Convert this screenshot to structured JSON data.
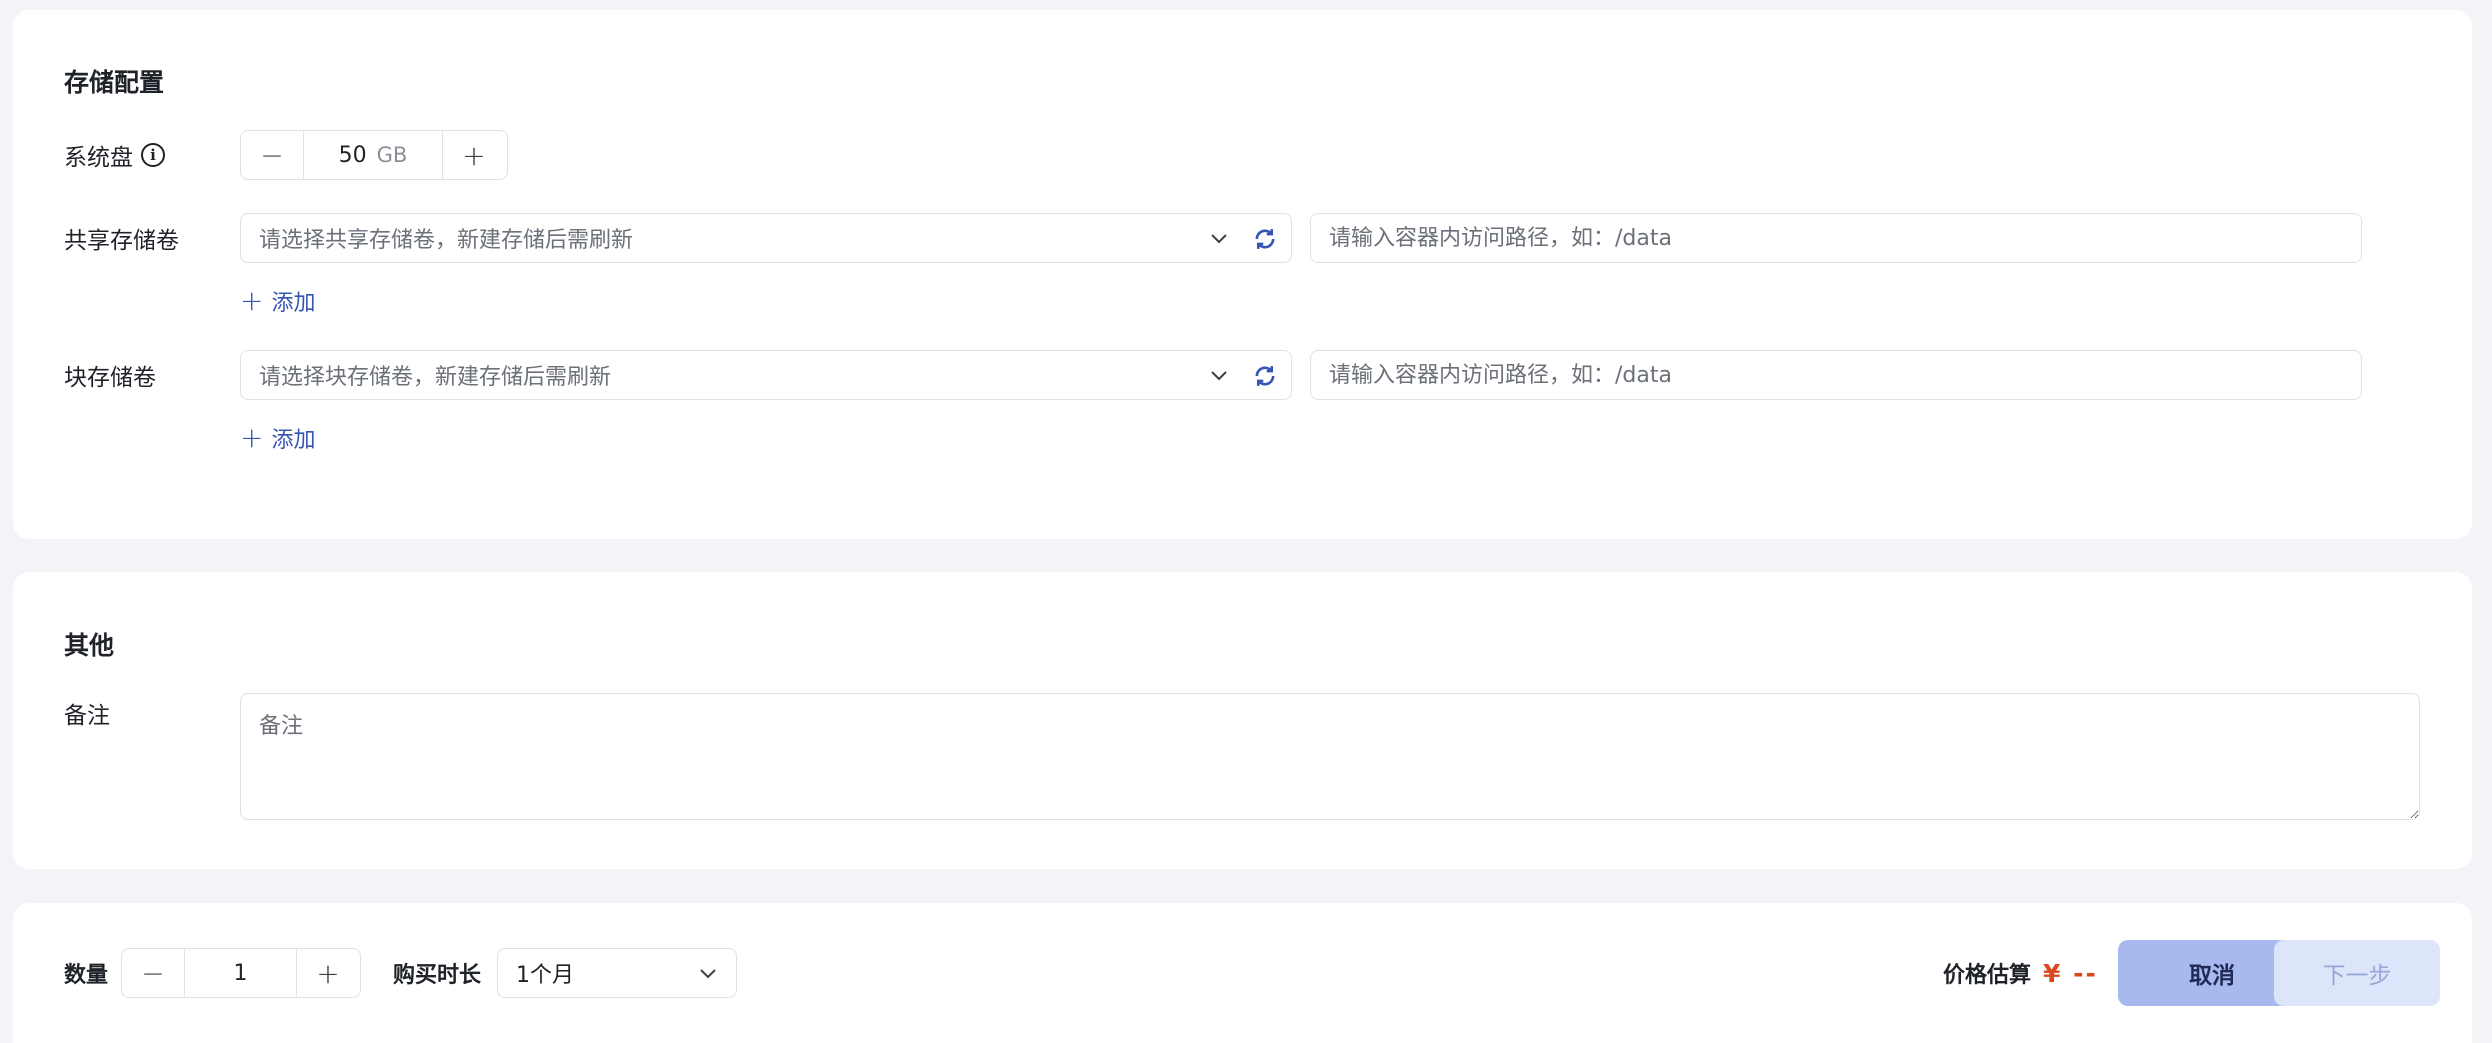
{
  "storage": {
    "title": "存储配置",
    "system_disk": {
      "label": "系统盘",
      "value": "50",
      "unit": "GB",
      "minus": "−",
      "plus": "+"
    },
    "shared_volume": {
      "label": "共享存储卷",
      "select_placeholder": "请选择共享存储卷，新建存储后需刷新",
      "path_placeholder": "请输入容器内访问路径，如：/data",
      "add_label": "添加"
    },
    "block_volume": {
      "label": "块存储卷",
      "select_placeholder": "请选择块存储卷，新建存储后需刷新",
      "path_placeholder": "请输入容器内访问路径，如：/data",
      "add_label": "添加"
    }
  },
  "other": {
    "title": "其他",
    "remark_label": "备注",
    "remark_placeholder": "备注"
  },
  "footer": {
    "quantity_label": "数量",
    "quantity_value": "1",
    "minus": "−",
    "plus": "+",
    "duration_label": "购买时长",
    "duration_value": "1个月",
    "price_label": "价格估算",
    "price_value": "¥ --",
    "cancel_label": "取消",
    "next_label": "下一步"
  },
  "colors": {
    "accent": "#3655b3",
    "price": "#d9481f",
    "cancel_bg": "#a8b9f0",
    "next_bg": "#dde5fa"
  }
}
